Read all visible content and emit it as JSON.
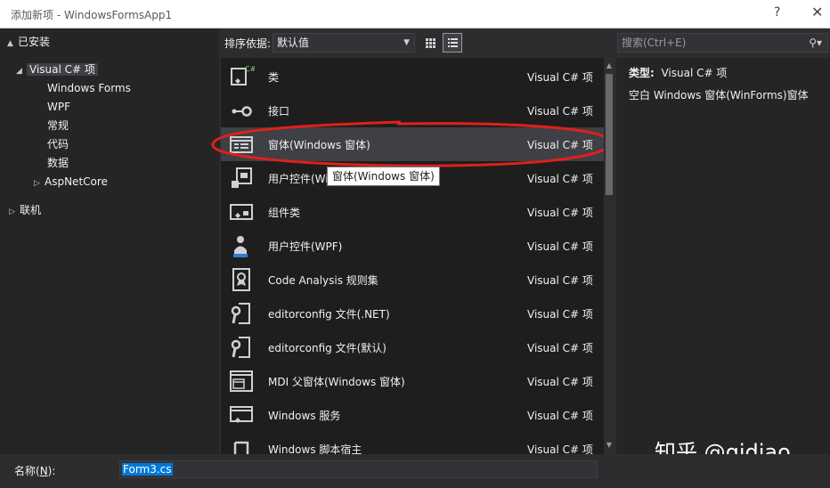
{
  "window": {
    "title": "添加新项 - WindowsFormsApp1",
    "help": "?",
    "close": "✕"
  },
  "tree": {
    "installed": "已安装",
    "visual_csharp": "Visual C# 项",
    "children": [
      "Windows Forms",
      "WPF",
      "常规",
      "代码",
      "数据"
    ],
    "aspnetcore": "AspNetCore",
    "online": "联机"
  },
  "sort": {
    "label": "排序依据:",
    "value": "默认值"
  },
  "items": [
    {
      "name": "类",
      "type": "Visual C# 项",
      "icon": "class-icon"
    },
    {
      "name": "接口",
      "type": "Visual C# 项",
      "icon": "interface-icon"
    },
    {
      "name": "窗体(Windows 窗体)",
      "type": "Visual C# 项",
      "icon": "form-icon"
    },
    {
      "name": "用户控件(Windows 窗体)",
      "type": "Visual C# 项",
      "icon": "user-control-icon"
    },
    {
      "name": "组件类",
      "type": "Visual C# 项",
      "icon": "component-icon"
    },
    {
      "name": "用户控件(WPF)",
      "type": "Visual C# 项",
      "icon": "wpf-user-control-icon"
    },
    {
      "name": "Code Analysis 规则集",
      "type": "Visual C# 项",
      "icon": "ruleset-icon"
    },
    {
      "name": "editorconfig 文件(.NET)",
      "type": "Visual C# 项",
      "icon": "editorconfig-icon"
    },
    {
      "name": "editorconfig 文件(默认)",
      "type": "Visual C# 项",
      "icon": "editorconfig-icon"
    },
    {
      "name": "MDI 父窗体(Windows 窗体)",
      "type": "Visual C# 项",
      "icon": "mdi-form-icon"
    },
    {
      "name": "Windows 服务",
      "type": "Visual C# 项",
      "icon": "service-icon"
    },
    {
      "name": "Windows 脚本宿主",
      "type": "Visual C# 项",
      "icon": "script-host-icon"
    }
  ],
  "tooltip": "窗体(Windows 窗体)",
  "search": {
    "placeholder": "搜索(Ctrl+E)"
  },
  "details": {
    "type_label": "类型:",
    "type_value": "Visual C# 项",
    "description": "空白 Windows 窗体(WinForms)窗体"
  },
  "bottom": {
    "name_label": "名称(",
    "name_key": "N",
    "name_label_end": "):",
    "name_value": "Form3.cs"
  },
  "watermark": "知乎 @qidiao",
  "colors": {
    "annotation": "#e0201a",
    "selection": "#0078d7"
  }
}
